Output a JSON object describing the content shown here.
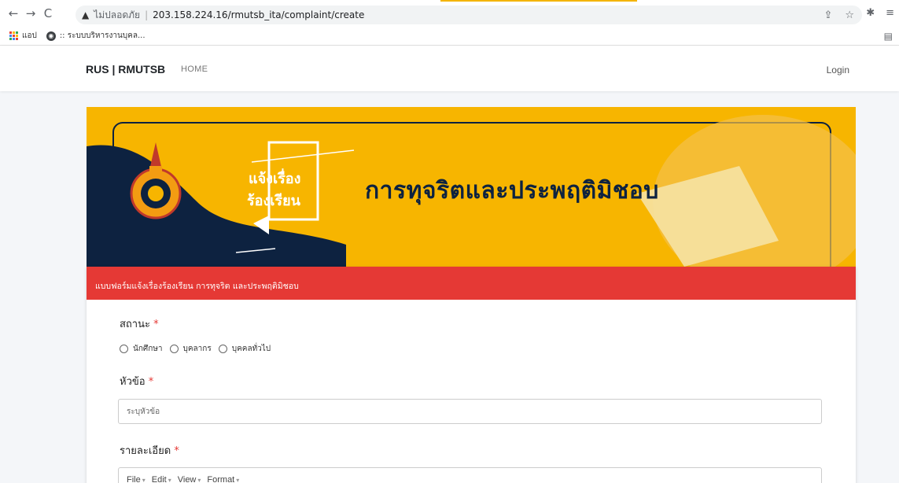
{
  "browser": {
    "not_secure_label": "ไม่ปลอดภัย",
    "url": "203.158.224.16/rmutsb_ita/complaint/create",
    "bookmarks": [
      {
        "label": "แอป",
        "icon": "apps-grid-icon"
      },
      {
        "label": ":: ระบบบริหารงานบุคล...",
        "icon": "globe-icon"
      }
    ]
  },
  "navbar": {
    "brand": "RUS | RMUTSB",
    "home": "HOME",
    "login": "Login"
  },
  "banner": {
    "tagline_line1": "แจ้งเรื่อง",
    "tagline_line2": "ร้องเรียน",
    "title": "การทุจริตและประพฤติมิชอบ",
    "colors": {
      "background": "#f7b500",
      "navy": "#0d2240"
    }
  },
  "form": {
    "header": "แบบฟอร์มแจ้งเรื่องร้องเรียน การทุจริต และประพฤติมิชอบ",
    "status_label": "สถานะ",
    "status_options": [
      "นักศึกษา",
      "บุคลากร",
      "บุคคลทั่วไป"
    ],
    "subject_label": "หัวข้อ",
    "subject_placeholder": "ระบุหัวข้อ",
    "detail_label": "รายละเอียด",
    "editor_menu": [
      "File",
      "Edit",
      "View",
      "Format"
    ],
    "required_mark": "*",
    "colors": {
      "header": "#e53935"
    }
  }
}
